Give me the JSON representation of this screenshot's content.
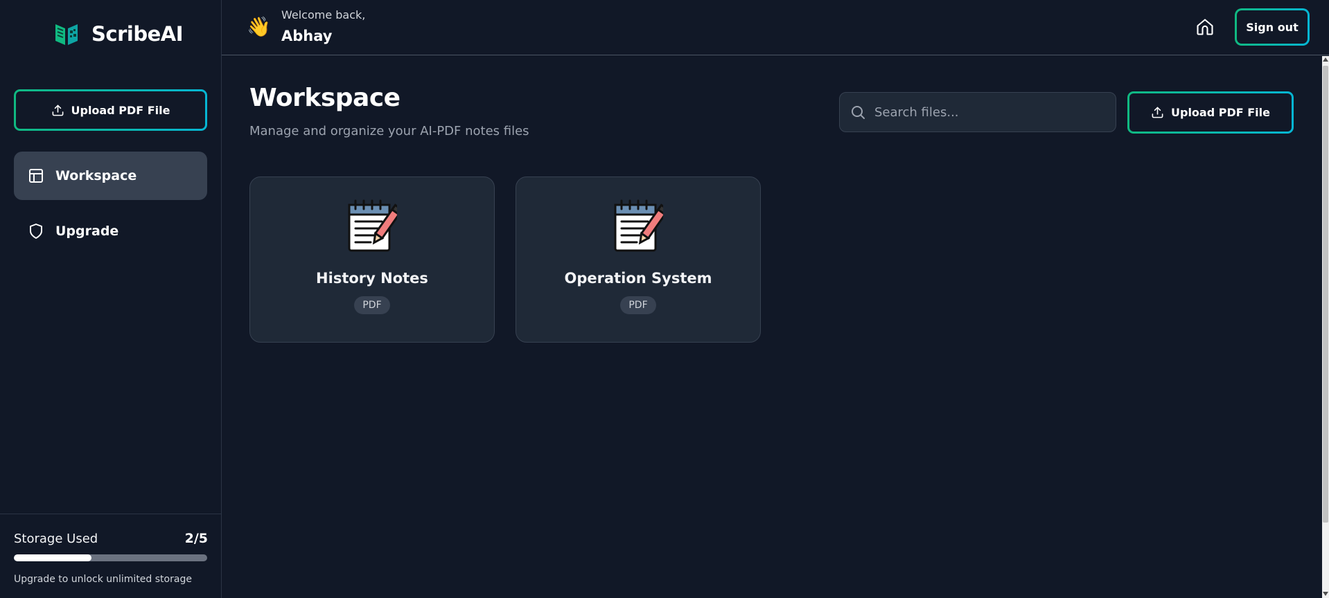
{
  "app": {
    "name": "ScribeAI",
    "logo_icon": "book-logo-icon",
    "accent_gradient": [
      "#10b981",
      "#06b6d4"
    ]
  },
  "header": {
    "wave_emoji": "👋",
    "welcome_text": "Welcome back,",
    "username": "Abhay",
    "home_icon": "home-icon",
    "signout_label": "Sign out"
  },
  "sidebar": {
    "upload_label": "Upload PDF File",
    "items": [
      {
        "label": "Workspace",
        "icon": "layout-icon",
        "active": true
      },
      {
        "label": "Upgrade",
        "icon": "shield-icon",
        "active": false
      }
    ],
    "storage": {
      "label": "Storage Used",
      "count": "2/5",
      "used": 2,
      "total": 5,
      "note": "Upgrade to unlock unlimited storage"
    }
  },
  "main": {
    "title": "Workspace",
    "subtitle": "Manage and organize your AI-PDF notes files",
    "search_placeholder": "Search files...",
    "upload_label": "Upload PDF File",
    "files": [
      {
        "title": "History Notes",
        "badge": "PDF",
        "icon": "notepad-pencil-icon"
      },
      {
        "title": "Operation System",
        "badge": "PDF",
        "icon": "notepad-pencil-icon"
      }
    ]
  }
}
